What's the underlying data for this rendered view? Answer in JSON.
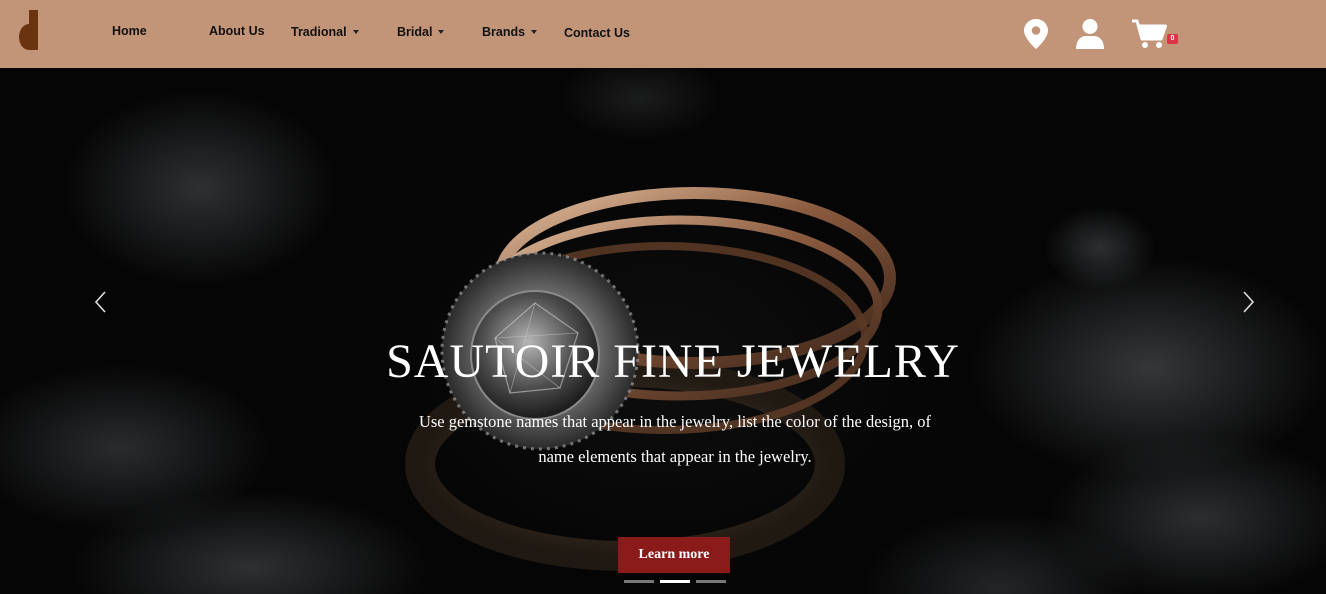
{
  "nav": {
    "logo_letter": "d",
    "items": [
      {
        "label": "Home",
        "dropdown": false
      },
      {
        "label": "About Us",
        "dropdown": false
      },
      {
        "label": "Tradional",
        "dropdown": true
      },
      {
        "label": "Bridal",
        "dropdown": true
      },
      {
        "label": "Brands",
        "dropdown": true
      },
      {
        "label": "Contact Us",
        "dropdown": false
      }
    ],
    "icons": [
      "location-pin-icon",
      "user-icon",
      "cart-icon"
    ],
    "cart_count": "0",
    "bg_color": "#c39578"
  },
  "hero": {
    "title": "SAUTOIR FINE JEWELRY",
    "subtitle_line1": "Use gemstone names that appear in the jewelry, list the color of the design, of",
    "subtitle_line2": "name elements that appear in the jewelry.",
    "button_label": "Learn more",
    "button_color": "#8b1a1a",
    "prev_icon": "chevron-left-icon",
    "next_icon": "chevron-right-icon",
    "slides_total": 3,
    "active_slide": 2
  }
}
